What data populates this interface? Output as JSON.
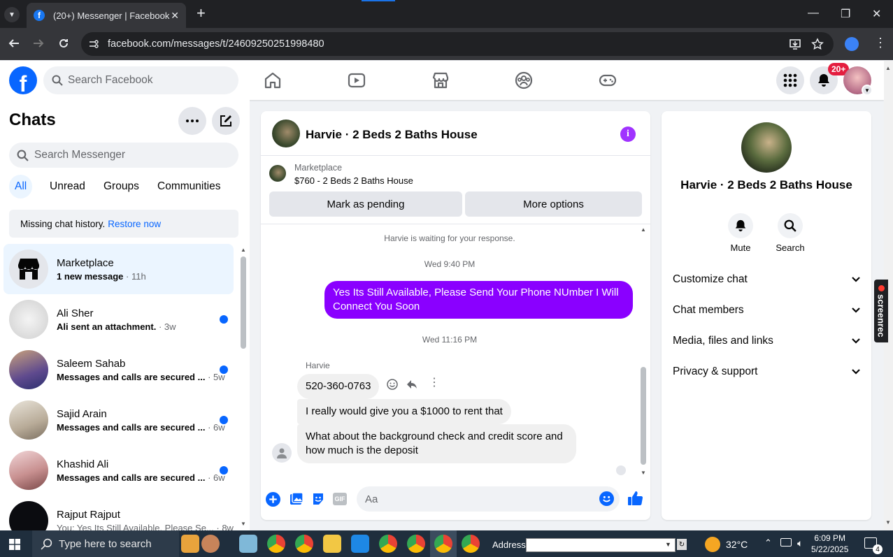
{
  "browser": {
    "tab_title": "(20+) Messenger | Facebook",
    "url": "facebook.com/messages/t/24609250251998480"
  },
  "fb": {
    "search_placeholder": "Search Facebook",
    "notif_badge": "20+"
  },
  "chats": {
    "title": "Chats",
    "search_placeholder": "Search Messenger",
    "filters": [
      "All",
      "Unread",
      "Groups",
      "Communities"
    ],
    "missing_text": "Missing chat history.",
    "restore_link": "Restore now",
    "items": [
      {
        "name": "Marketplace",
        "preview": "1 new message",
        "time": "· 11h"
      },
      {
        "name": "Ali Sher",
        "preview": "Ali sent an attachment.",
        "time": "· 3w"
      },
      {
        "name": "Saleem Sahab",
        "preview": "Messages and calls are secured ...",
        "time": "· 5w"
      },
      {
        "name": "Sajid Arain",
        "preview": "Messages and calls are secured ...",
        "time": "· 6w"
      },
      {
        "name": "Khashid Ali",
        "preview": "Messages and calls are secured ...",
        "time": "· 6w"
      },
      {
        "name": "Rajput Rajput",
        "preview": "You: Yes Its Still Available, Please Se...",
        "time": "· 8w"
      }
    ]
  },
  "conversation": {
    "title": "Harvie · 2 Beds 2 Baths House",
    "marketplace_label": "Marketplace",
    "listing": "$760 - 2 Beds 2 Baths House",
    "btn_pending": "Mark as pending",
    "btn_more": "More options",
    "waiting": "Harvie is waiting for your response.",
    "time1": "Wed 9:40 PM",
    "out_msg": "Yes Its Still Available, Please Send Your Phone NUmber I Will Connect You Soon",
    "time2": "Wed 11:16 PM",
    "sender": "Harvie",
    "in_msgs": [
      "520-360-0763",
      "I really would give you a $1000  to  rent that",
      "What about the background check and credit score and how much is the deposit"
    ],
    "composer_placeholder": "Aa"
  },
  "details": {
    "name": "Harvie · 2 Beds 2 Baths House",
    "mute": "Mute",
    "search": "Search",
    "sections": [
      "Customize chat",
      "Chat members",
      "Media, files and links",
      "Privacy & support"
    ]
  },
  "screenrec": "screenrec",
  "taskbar": {
    "search": "Type here to search",
    "address_label": "Address",
    "temp": "32°C",
    "time": "6:09 PM",
    "date": "5/22/2025",
    "notif_count": "4"
  }
}
